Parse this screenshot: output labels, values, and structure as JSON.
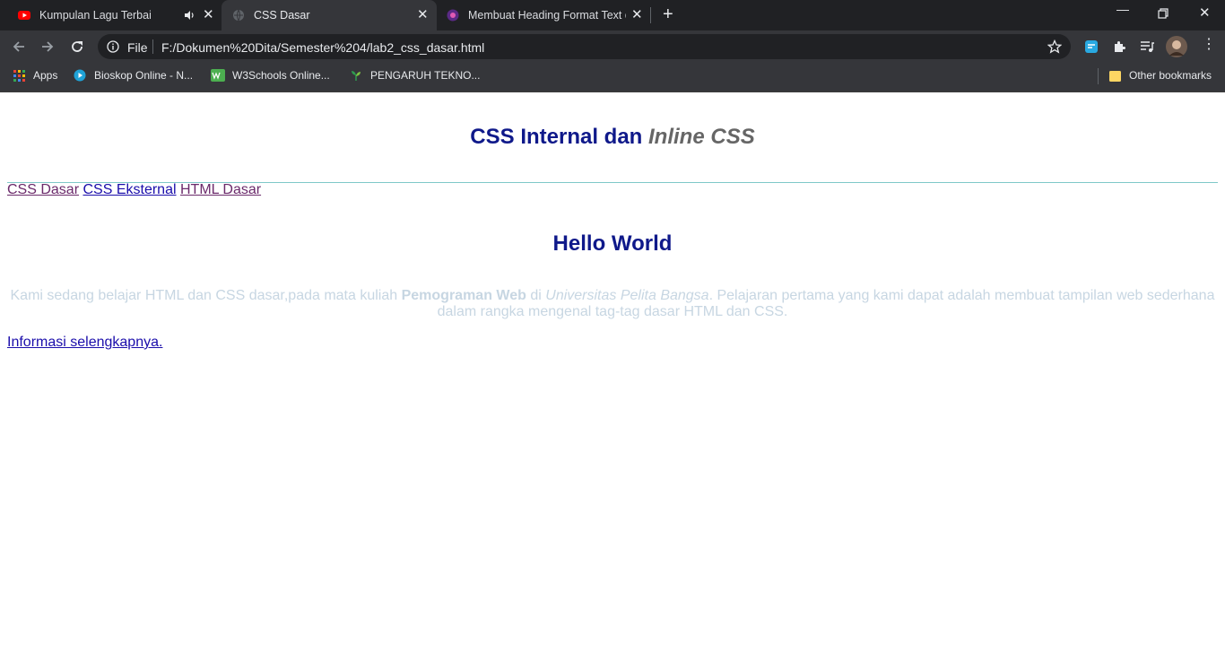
{
  "browser": {
    "tabs": [
      {
        "title": "Kumpulan Lagu Terbaik | Cov",
        "icon": "youtube-icon",
        "audio": true,
        "active": false
      },
      {
        "title": "CSS Dasar",
        "icon": "globe-icon",
        "audio": false,
        "active": true
      },
      {
        "title": "Membuat Heading Format Text d",
        "icon": "site-icon",
        "audio": false,
        "active": false
      }
    ],
    "new_tab_label": "+",
    "address": {
      "scheme_label": "File",
      "url": "F:/Dokumen%20Dita/Semester%204/lab2_css_dasar.html"
    },
    "bookmarks": [
      {
        "label": "Apps",
        "icon": "apps-grid-icon"
      },
      {
        "label": "Bioskop Online - N...",
        "icon": "play-icon"
      },
      {
        "label": "W3Schools Online...",
        "icon": "w3schools-icon"
      },
      {
        "label": "PENGARUH TEKNO...",
        "icon": "plant-icon"
      }
    ],
    "other_bookmarks": "Other bookmarks"
  },
  "page": {
    "heading_main": "CSS Internal dan",
    "heading_italic": "Inline CSS",
    "nav_links": [
      "CSS Dasar",
      "CSS Eksternal",
      "HTML Dasar"
    ],
    "hello": "Hello World",
    "paragraph": {
      "part1": "Kami sedang belajar HTML dan CSS dasar,pada mata kuliah",
      "bold": "Pemograman Web",
      "part2": "di",
      "italic": "Universitas Pelita Bangsa",
      "part3": ". Pelajaran pertama yang kami dapat adalah membuat tampilan web sederhana dalam rangka mengenal tag-tag dasar HTML dan CSS."
    },
    "more_link": "Informasi selengkapnya."
  },
  "colors": {
    "heading": "#0f198a",
    "paragraph": "#c7d6e2",
    "link": "#1a0dab",
    "visited": "#6b2a6b"
  }
}
